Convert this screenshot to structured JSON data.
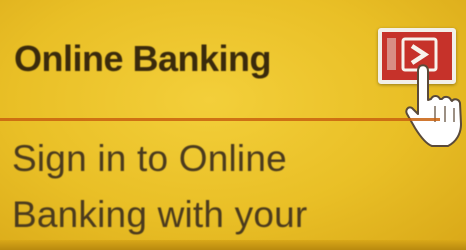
{
  "banking_panel": {
    "title": "Online Banking",
    "go_button_icon": "right-arrow-icon",
    "cursor_icon": "hand-pointer-icon",
    "description_line_1": "Sign in to Online",
    "description_line_2": "Banking with your"
  },
  "colors": {
    "panel_background": "#e9bf26",
    "title_text": "#3a2a0c",
    "button_red": "#c6322a",
    "divider_orange": "#c8620f"
  }
}
